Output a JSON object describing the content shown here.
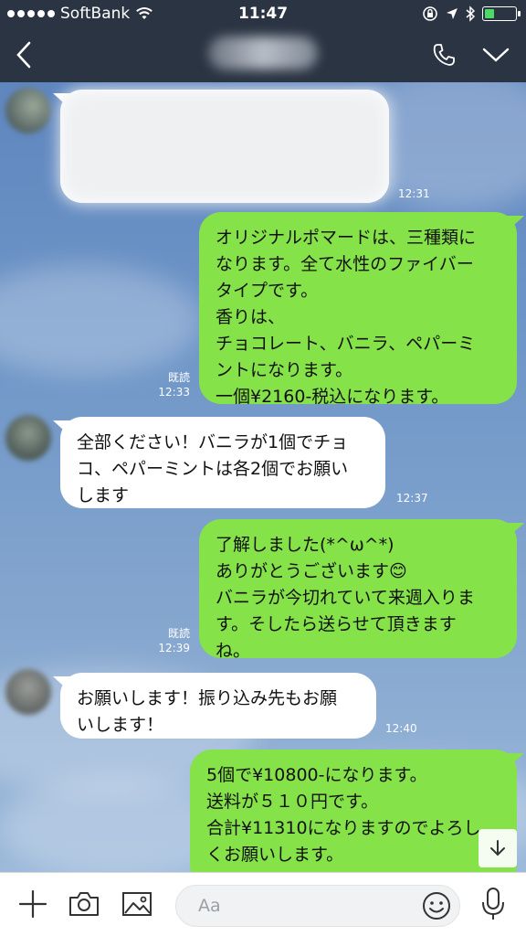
{
  "status_bar": {
    "carrier": "SoftBank",
    "time": "11:47"
  },
  "header": {
    "back_icon": "chevron-left-icon",
    "call_icon": "phone-icon",
    "menu_icon": "chevron-down-icon"
  },
  "messages": [
    {
      "side": "in",
      "text": "",
      "time": "12:31",
      "blurred": true
    },
    {
      "side": "out",
      "text": "オリジナルポマードは、三種類に\nなります。全て水性のファイバー\nタイプです。\n香りは、\nチョコレート、バニラ、ペパーミ\nントになります。\n一個¥2160-税込になります。",
      "read": "既読",
      "time": "12:33"
    },
    {
      "side": "in",
      "text": "全部ください！バニラが1個でチョ\nコ、ペパーミントは各2個でお願い\nします",
      "time": "12:37"
    },
    {
      "side": "out",
      "text": "了解しました(*^ω^*)\nありがとうございます😊\nバニラが今切れていて来週入りま\nす。そしたら送らせて頂きます\nね。",
      "read": "既読",
      "time": "12:39"
    },
    {
      "side": "in",
      "text": "お願いします！振り込み先もお願\nいします！",
      "time": "12:40"
    },
    {
      "side": "out",
      "text": "5個で¥10800-になります。\n送料が５１０円です。\n合計¥11310になりますのでよろし\nくお願いします。"
    }
  ],
  "input_bar": {
    "placeholder": "Aa",
    "icons": [
      "plus-icon",
      "camera-icon",
      "image-icon",
      "emoji-icon",
      "microphone-icon"
    ]
  },
  "colors": {
    "header_bg": "#2b3442",
    "outgoing_bubble": "#85e249",
    "incoming_bubble": "#ffffff",
    "chat_bg": "#7097c8"
  }
}
